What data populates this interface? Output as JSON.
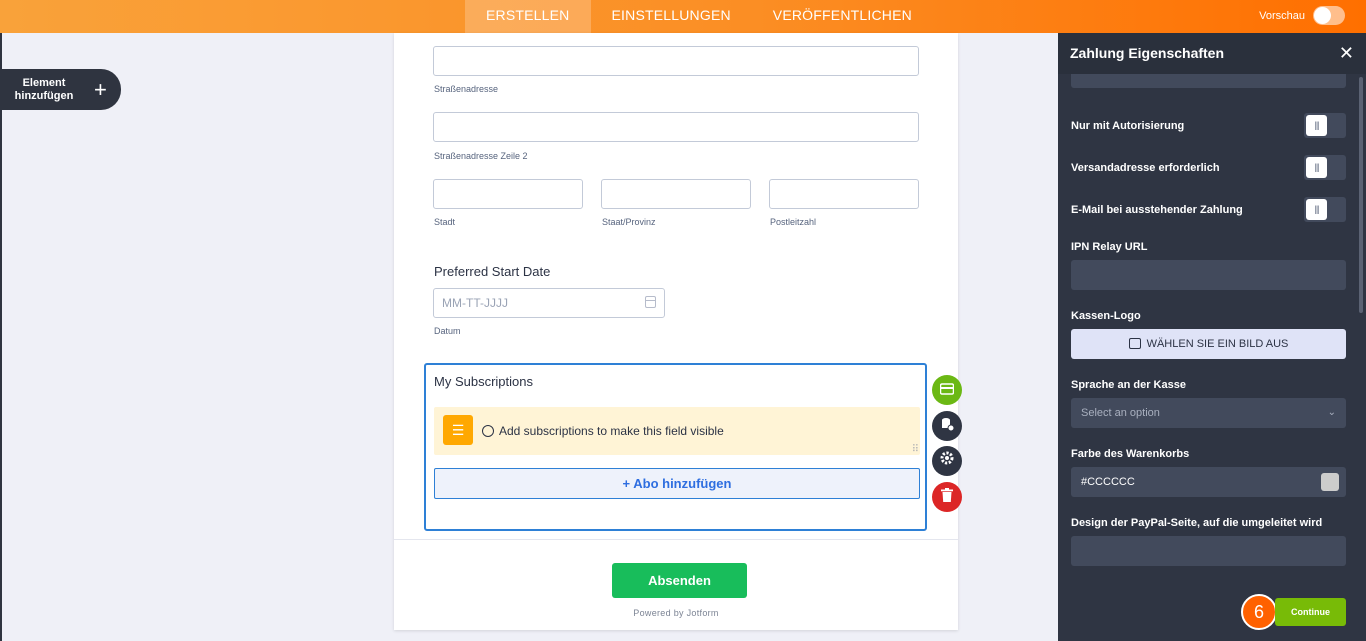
{
  "topbar": {
    "tabs": [
      "ERSTELLEN",
      "EINSTELLUNGEN",
      "VERÖFFENTLICHEN"
    ],
    "preview_label": "Vorschau"
  },
  "add_element": {
    "label": "Element hinzufügen",
    "icon": "plus-icon"
  },
  "form": {
    "address": {
      "street_label": "Straßenadresse",
      "street2_label": "Straßenadresse Zeile 2",
      "city_label": "Stadt",
      "state_label": "Staat/Provinz",
      "zip_label": "Postleitzahl"
    },
    "date": {
      "question": "Preferred Start Date",
      "placeholder": "MM-TT-JJJJ",
      "sublabel": "Datum"
    },
    "subscriptions": {
      "title": "My Subscriptions",
      "notice": "Add subscriptions to make this field visible",
      "add_button": "+ Abo hinzufügen"
    },
    "submit_label": "Absenden",
    "powered_by": "Powered by Jotform"
  },
  "field_tools": [
    "payment-icon",
    "database-icon",
    "gear-icon",
    "trash-icon"
  ],
  "colors": {
    "accent_orange": "#ff6f00",
    "selection_blue": "#2e80d6",
    "submit_green": "#18bd5b",
    "continue_green": "#78bb07",
    "tool_green": "#6bb814",
    "tool_dark": "#2f3543",
    "tool_red": "#dc2626",
    "cart_color": "#CCCCCC"
  },
  "panel": {
    "title": "Zahlung Eigenschaften",
    "auth_only_label": "Nur mit Autorisierung",
    "shipping_required_label": "Versandadresse erforderlich",
    "pending_email_label": "E-Mail bei ausstehender Zahlung",
    "ipn_label": "IPN Relay URL",
    "logo_label": "Kassen-Logo",
    "logo_button": "WÄHLEN SIE EIN BILD AUS",
    "language_label": "Sprache an der Kasse",
    "language_placeholder": "Select an option",
    "cart_color_label": "Farbe des Warenkorbs",
    "cart_color_value": "#CCCCCC",
    "paypal_design_label": "Design der PayPal-Seite, auf die umgeleitet wird",
    "continue_label": "Continue",
    "step_number": "6"
  }
}
